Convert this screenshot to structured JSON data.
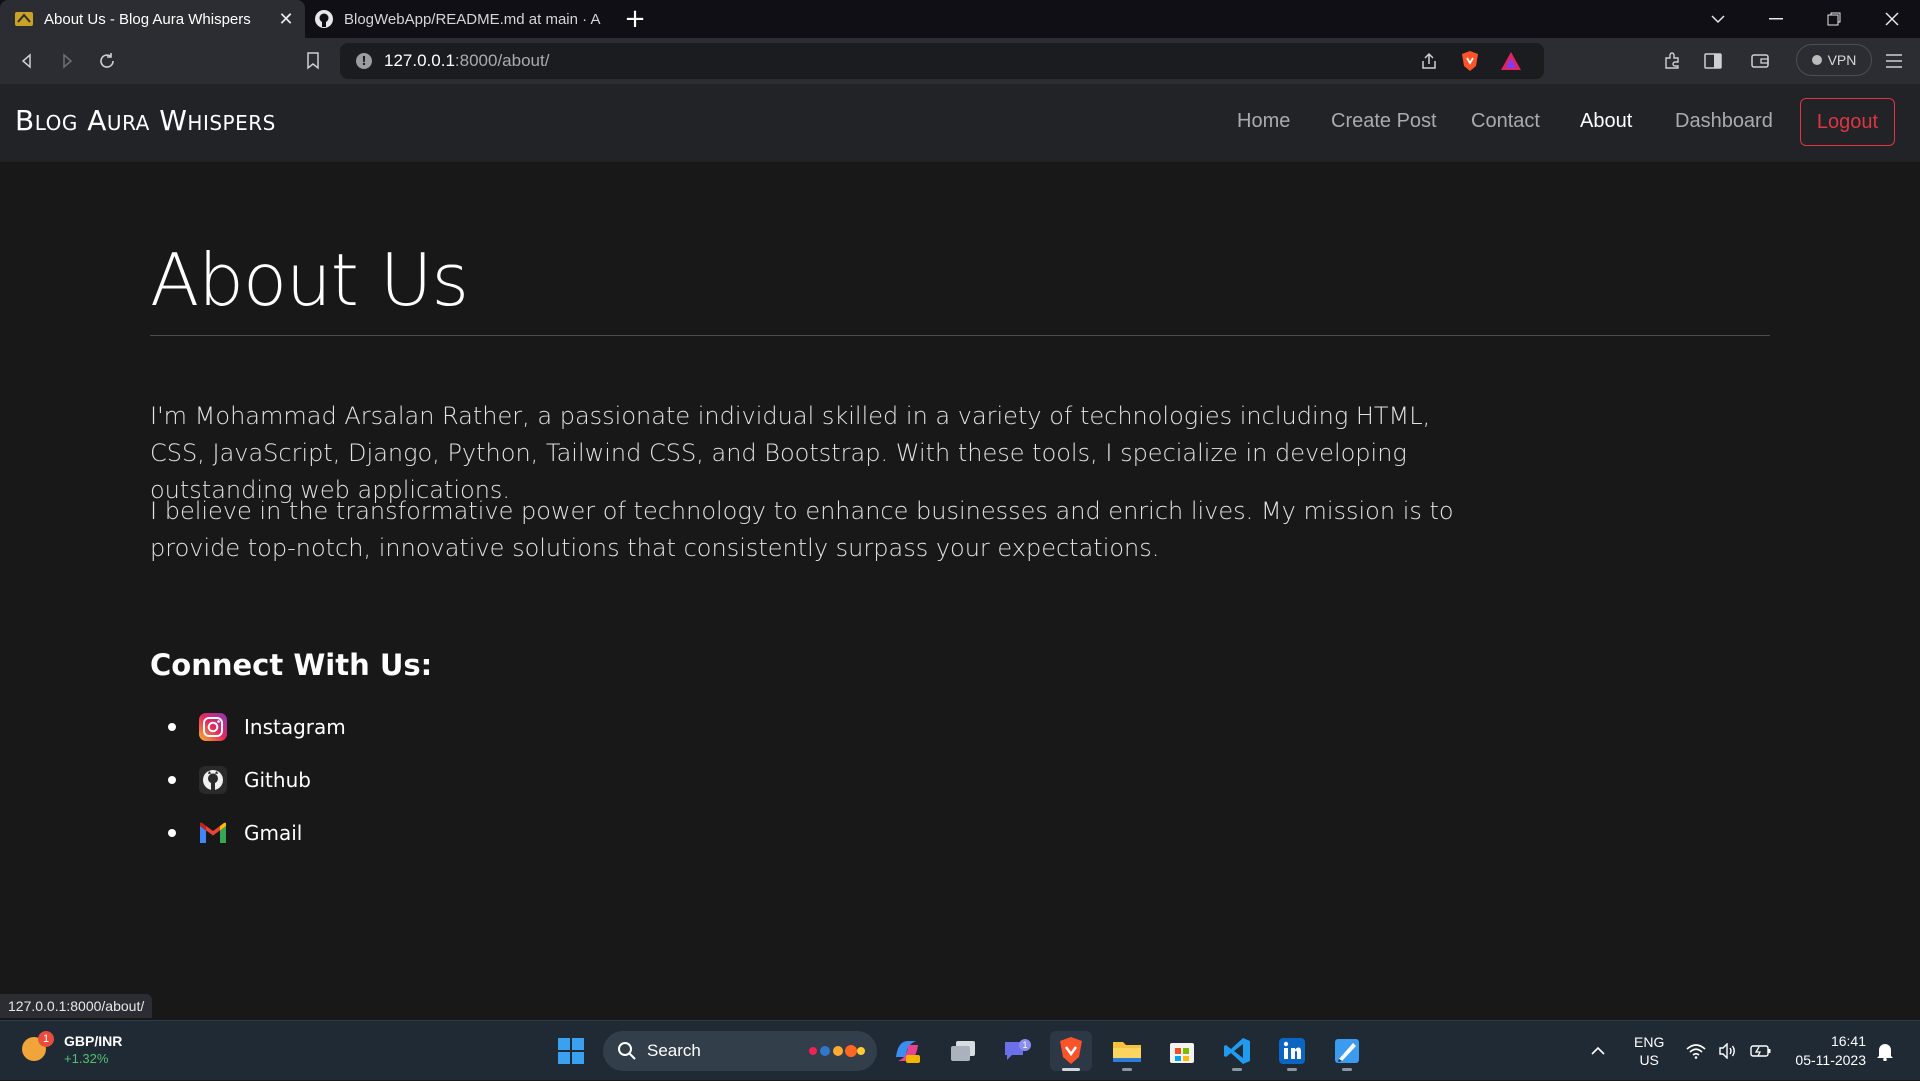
{
  "browser": {
    "tabs": [
      {
        "title": "About Us - Blog Aura Whispers",
        "active": true
      },
      {
        "title": "BlogWebApp/README.md at main · A",
        "active": false
      }
    ],
    "address": {
      "host": "127.0.0.1",
      "path": ":8000/about/"
    },
    "vpn_label": "VPN",
    "status_url": "127.0.0.1:8000/about/"
  },
  "site": {
    "brand": "Blog Aura Whispers",
    "nav": [
      "Home",
      "Create Post",
      "Contact",
      "About",
      "Dashboard"
    ],
    "active_nav": "About",
    "logout_label": "Logout"
  },
  "page": {
    "title": "About Us",
    "paragraphs": [
      "I'm Mohammad Arsalan Rather, a passionate individual skilled in a variety of technologies including HTML, CSS, JavaScript, Django, Python, Tailwind CSS, and Bootstrap. With these tools, I specialize in developing outstanding web applications.",
      "I believe in the transformative power of technology to enhance businesses and enrich lives. My mission is to provide top-notch, innovative solutions that consistently surpass your expectations."
    ],
    "connect_heading": "Connect With Us:",
    "social": [
      {
        "label": "Instagram",
        "icon": "instagram-icon"
      },
      {
        "label": "Github",
        "icon": "github-icon"
      },
      {
        "label": "Gmail",
        "icon": "gmail-icon"
      }
    ]
  },
  "taskbar": {
    "ticker": {
      "symbol": "GBP/INR",
      "change": "+1.32%",
      "badge": "1"
    },
    "search_label": "Search",
    "chat_badge": "1",
    "lang": {
      "line1": "ENG",
      "line2": "US"
    },
    "time": "16:41",
    "date": "05-11-2023"
  },
  "colors": {
    "background": "#181818",
    "navbar": "#212327",
    "logout_accent": "#dc3545"
  }
}
